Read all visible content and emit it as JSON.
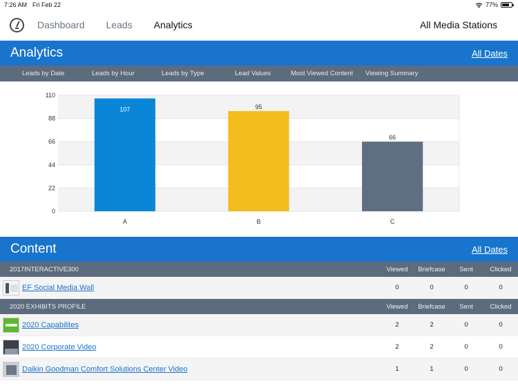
{
  "status": {
    "time": "7:26 AM",
    "date": "Fri Feb 22",
    "battery": "77%",
    "battery_level": 0.77
  },
  "nav": {
    "items": [
      {
        "label": "Dashboard"
      },
      {
        "label": "Leads"
      },
      {
        "label": "Analytics"
      }
    ],
    "station": "All Media Stations"
  },
  "analytics": {
    "title": "Analytics",
    "dates_link": "All Dates",
    "tabs": [
      "Leads by Date",
      "Leads by Hour",
      "Leads by Type",
      "Lead Values",
      "Most Viewed Content",
      "Viewing Summary"
    ]
  },
  "chart_data": {
    "type": "bar",
    "categories": [
      "A",
      "B",
      "C"
    ],
    "values": [
      107,
      95,
      66
    ],
    "colors": [
      "#0a86d8",
      "#f2bd1d",
      "#5f6f82"
    ],
    "yticks": [
      0,
      22,
      44,
      66,
      88,
      110
    ],
    "ylim": [
      0,
      110
    ],
    "grid": "alternating horizontal bands"
  },
  "content": {
    "title": "Content",
    "dates_link": "All Dates",
    "columns": [
      "Viewed",
      "Briefcase",
      "Sent",
      "Clicked"
    ],
    "groups": [
      {
        "name": "2017INTERACTIVE300",
        "rows": [
          {
            "name": "EF Social Media Wall",
            "values": [
              0,
              0,
              0,
              0
            ]
          }
        ]
      },
      {
        "name": "2020 EXHIBITS PROFILE",
        "rows": [
          {
            "name": "2020 Capabilites",
            "values": [
              2,
              2,
              0,
              0
            ]
          },
          {
            "name": "2020 Corporate Video",
            "values": [
              2,
              2,
              0,
              0
            ]
          },
          {
            "name": "Daikin Goodman Comfort Solutions Center Video",
            "values": [
              1,
              1,
              0,
              0
            ]
          }
        ]
      }
    ]
  }
}
